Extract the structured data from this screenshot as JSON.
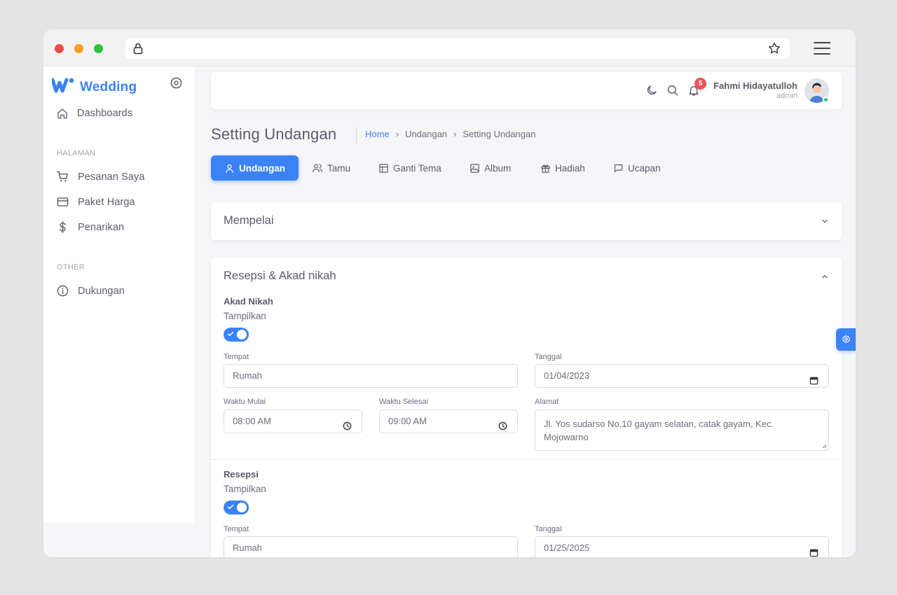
{
  "brand": {
    "name": "Wedding"
  },
  "sidebar": {
    "items": [
      {
        "label": "Dashboards",
        "icon": "home-icon"
      },
      {
        "label": "Pesanan Saya",
        "icon": "cart-icon"
      },
      {
        "label": "Paket Harga",
        "icon": "credit-card-icon"
      },
      {
        "label": "Penarikan",
        "icon": "dollar-icon"
      },
      {
        "label": "Dukungan",
        "icon": "info-icon"
      }
    ],
    "sections": {
      "halaman": "HALAMAN",
      "other": "OTHER"
    }
  },
  "topbar": {
    "notification_count": "5",
    "user_name": "Fahmi Hidayatulloh",
    "user_role": "admin"
  },
  "page": {
    "title": "Setting Undangan",
    "breadcrumb": [
      "Home",
      "Undangan",
      "Setting Undangan"
    ]
  },
  "tabs": [
    {
      "label": "Undangan",
      "icon": "user-icon",
      "active": true
    },
    {
      "label": "Tamu",
      "icon": "users-icon"
    },
    {
      "label": "Ganti Tema",
      "icon": "layout-icon"
    },
    {
      "label": "Album",
      "icon": "photo-icon"
    },
    {
      "label": "Hadiah",
      "icon": "gift-icon"
    },
    {
      "label": "Ucapan",
      "icon": "message-icon"
    }
  ],
  "mempelai": {
    "title": "Mempelai",
    "expanded": false
  },
  "resepsi_section": {
    "title": "Resepsi & Akad nikah",
    "expanded": true,
    "akad": {
      "title": "Akad Nikah",
      "show_label": "Tampilkan",
      "show": true,
      "tempat_label": "Tempat",
      "tempat": "Rumah",
      "tanggal_label": "Tanggal",
      "tanggal": "01/04/2023",
      "mulai_label": "Waktu Mulai",
      "mulai": "08:00 AM",
      "selesai_label": "Waktu Selesai",
      "selesai": "09:00 AM",
      "alamat_label": "Alamat",
      "alamat": "Jl. Yos sudarso No.10 gayam selatan, catak gayam, Kec. Mojowarno"
    },
    "resepsi": {
      "title": "Resepsi",
      "show_label": "Tampilkan",
      "show": true,
      "tempat_label": "Tempat",
      "tempat": "Rumah",
      "tanggal_label": "Tanggal",
      "tanggal": "01/25/2025"
    }
  },
  "colors": {
    "primary": "#3b82f6",
    "badge": "#ea5455",
    "online": "#28c76f"
  }
}
